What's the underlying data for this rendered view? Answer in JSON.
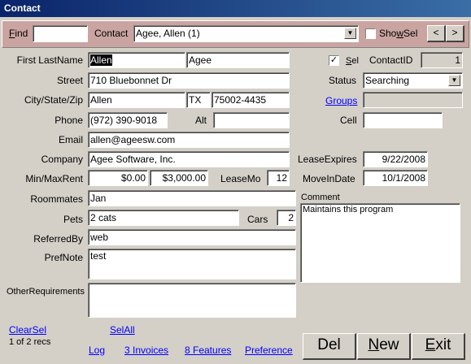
{
  "window": {
    "title": "Contact"
  },
  "top": {
    "find_label": "Find",
    "find_value": "",
    "contact_label": "Contact",
    "contact_value": "Agee, Allen (1)",
    "showsel_label": "ShowSel",
    "prev_glyph": "<",
    "next_glyph": ">"
  },
  "form": {
    "first_last_label": "First LastName",
    "first_name": "Allen",
    "last_name": "Agee",
    "street_label": "Street",
    "street": "710 Bluebonnet Dr",
    "csz_label": "City/State/Zip",
    "city": "Allen",
    "state": "TX",
    "zip": "75002-4435",
    "phone_label": "Phone",
    "phone": "(972) 390-9018",
    "alt_label": "Alt",
    "alt": "",
    "email_label": "Email",
    "email": "allen@ageesw.com",
    "company_label": "Company",
    "company": "Agee Software, Inc.",
    "minmax_label": "Min/MaxRent",
    "min_rent": "$0.00",
    "max_rent": "$3,000.00",
    "leasemo_label": "LeaseMo",
    "leasemo": "12",
    "roommates_label": "Roommates",
    "roommates": "Jan",
    "pets_label": "Pets",
    "pets": "2 cats",
    "cars_label": "Cars",
    "cars": "2",
    "referred_label": "ReferredBy",
    "referred": "web",
    "prefnote_label": "PrefNote",
    "prefnote": "test",
    "otherreq_label": "OtherRequirements",
    "otherreq": ""
  },
  "right": {
    "sel_label": "Sel",
    "contactid_label": "ContactID",
    "contactid": "1",
    "status_label": "Status",
    "status": "Searching",
    "groups_link": "Groups",
    "groups_value": "",
    "cell_label": "Cell",
    "cell": "",
    "leaseexpires_label": "LeaseExpires",
    "leaseexpires": "9/22/2008",
    "moveindate_label": "MoveInDate",
    "moveindate": "10/1/2008",
    "comment_label": "Comment",
    "comment": "Maintains this program"
  },
  "bottom": {
    "clearsel": "ClearSel",
    "selall": "SelAll",
    "recs": "1 of 2 recs",
    "log": "Log",
    "invoices": "3 Invoices",
    "features": "8 Features",
    "preference": "Preference",
    "del": "Del",
    "new": "New",
    "exit": "Exit"
  }
}
